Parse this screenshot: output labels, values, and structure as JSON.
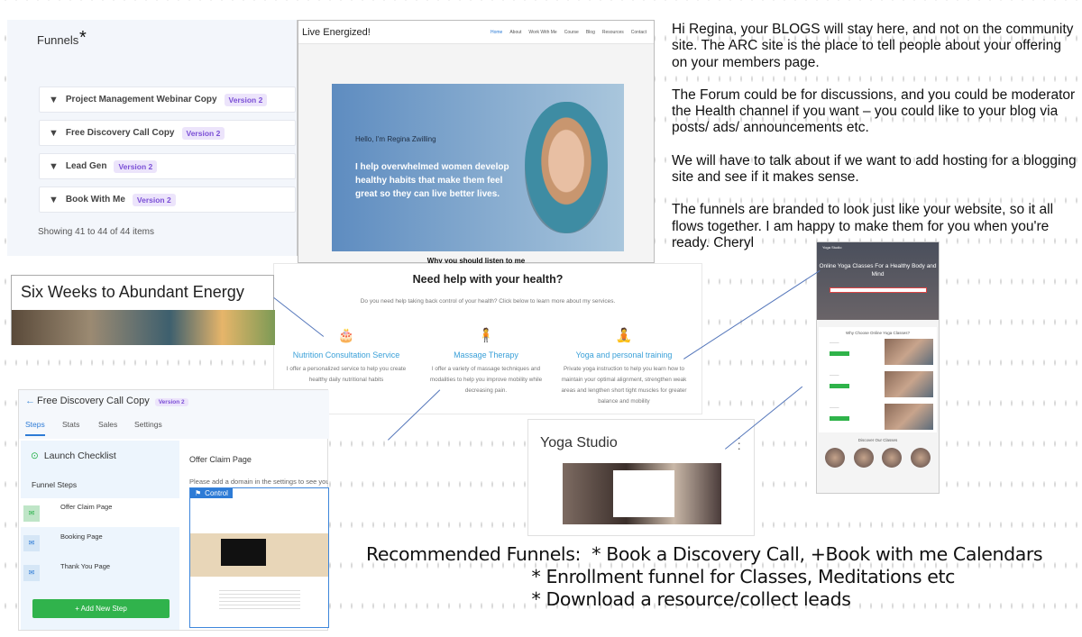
{
  "funnels_panel": {
    "title": "Funnels",
    "star": "*",
    "rows": [
      {
        "name": "Project Management Webinar Copy",
        "version": "Version 2"
      },
      {
        "name": "Free Discovery Call Copy",
        "version": "Version 2"
      },
      {
        "name": "Lead Gen",
        "version": "Version 2"
      },
      {
        "name": "Book With Me",
        "version": "Version 2"
      }
    ],
    "showing": "Showing 41 to 44 of 44 items"
  },
  "website": {
    "brand": "Live Energized!",
    "menu": [
      "Home",
      "About",
      "Work With Me",
      "Course",
      "Blog",
      "Resources",
      "Contact"
    ],
    "hello": "Hello, I'm Regina Zwilling",
    "pitch": "I help overwhelmed women develop healthy habits that make them feel great so they can live better lives.",
    "why": "Why you should listen to me"
  },
  "message": [
    "Hi Regina, your BLOGS will stay here, and not on the community site.  The ARC site is the place to tell people about your offering on your members page.",
    "The Forum could be for discussions, and you could be moderator the Health channel if you want – you could like to your blog via posts/ ads/ announcements etc.",
    "We will have to talk about if we want to add hosting for a blogging site and see if it makes sense.",
    "The funnels are branded to look just like your website, so it all flows together.  I am happy to make them for you when you're ready.  Cheryl"
  ],
  "abundant": {
    "title": "Six Weeks to Abundant Energy"
  },
  "services": {
    "heading": "Need help with your health?",
    "subheading": "Do you need help taking back control of your health? Click below to learn more about my services.",
    "items": [
      {
        "icon": "cake-icon",
        "glyph": "🎂",
        "name": "Nutrition Consultation Service",
        "desc": "I offer a personalized service to help you create healthy daily nutritional habits"
      },
      {
        "icon": "person-icon",
        "glyph": "🧍",
        "name": "Massage Therapy",
        "desc": "I offer a variety of massage techniques and modalities to help you improve mobility while decreasing pain."
      },
      {
        "icon": "yoga-icon",
        "glyph": "🧘",
        "name": "Yoga and personal training",
        "desc": "Private yoga instruction to help you learn how to maintain your optimal alignment, strengthen weak areas and lengthen short tight muscles for greater balance and mobility"
      }
    ]
  },
  "yoga_page": {
    "logo": "Yoga Studio",
    "heading": "Online Yoga Classes For a Healthy Body and Mind",
    "why": "Why Choose Online Yoga Classes?",
    "discover": "Discover Our Classes"
  },
  "yoga_studio": {
    "title": "Yoga Studio"
  },
  "editor": {
    "back": "←",
    "name": "Free Discovery Call Copy",
    "version": "Version 2",
    "tabs": [
      "Steps",
      "Stats",
      "Sales",
      "Settings"
    ],
    "checklist": "Launch Checklist",
    "funnel_steps": "Funnel Steps",
    "steps": [
      "Offer Claim Page",
      "Booking Page",
      "Thank You Page"
    ],
    "add_step": "+ Add New Step",
    "page_title": "Offer Claim Page",
    "domain_note": "Please add a domain in the settings to see your",
    "control": "Control"
  },
  "recommended": "Recommended Funnels:  * Book a Discovery Call, +Book with me Calendars\n                              * Enrollment funnel for Classes, Meditations etc\n                              * Download a resource/collect leads"
}
